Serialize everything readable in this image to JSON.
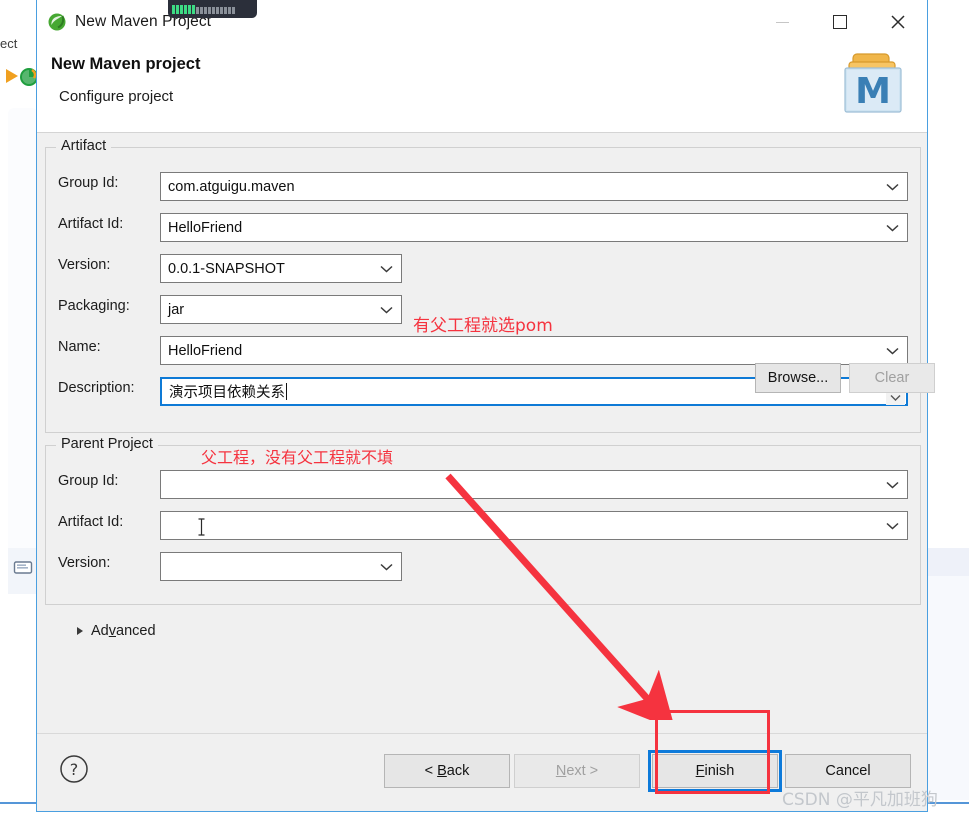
{
  "backdrop": {
    "toolbar_text": "ect",
    "run_icon": "run-icon",
    "maven_icon": "maven-green-icon",
    "view_icon": "console-view-icon"
  },
  "titlebar": {
    "icon": "maven-leaf-icon",
    "title": "New Maven Project",
    "minimize": "minimize-icon",
    "maximize": "maximize-icon",
    "close": "close-icon"
  },
  "header": {
    "title": "New Maven project",
    "subtitle": "Configure project",
    "logo": "maven-folder-m-icon"
  },
  "artifact": {
    "legend": "Artifact",
    "fields": [
      {
        "label": "Group Id:",
        "value": "com.atguigu.maven",
        "type": "combo-wide"
      },
      {
        "label": "Artifact Id:",
        "value": "HelloFriend",
        "type": "combo-wide"
      },
      {
        "label": "Version:",
        "value": "0.0.1-SNAPSHOT",
        "type": "combo-narrow"
      },
      {
        "label": "Packaging:",
        "value": "jar",
        "type": "combo-narrow"
      },
      {
        "label": "Name:",
        "value": "HelloFriend",
        "type": "combo-wide"
      },
      {
        "label": "Description:",
        "value": "演示项目依赖关系",
        "type": "text-focused"
      }
    ]
  },
  "parent": {
    "legend": "Parent Project",
    "fields": [
      {
        "label": "Group Id:",
        "value": "",
        "type": "combo-wide"
      },
      {
        "label": "Artifact Id:",
        "value": "",
        "type": "combo-wide"
      },
      {
        "label": "Version:",
        "value": "",
        "type": "combo-narrow"
      }
    ],
    "browse_label": "Browse...",
    "clear_label": "Clear"
  },
  "advanced": {
    "label_pre": "Ad",
    "label_mnemonic": "v",
    "label_post": "anced",
    "expanded": false
  },
  "footer": {
    "help_icon": "help-question-icon",
    "buttons": [
      {
        "name": "back",
        "pre": "< ",
        "mnemonic": "B",
        "post": "ack",
        "disabled": false,
        "focused": false
      },
      {
        "name": "next",
        "pre": "",
        "mnemonic": "N",
        "post": "ext >",
        "disabled": true,
        "focused": false
      },
      {
        "name": "finish",
        "pre": "",
        "mnemonic": "F",
        "post": "inish",
        "disabled": false,
        "focused": true
      },
      {
        "name": "cancel",
        "pre": "",
        "mnemonic": "",
        "post": "Cancel",
        "disabled": false,
        "focused": false
      }
    ]
  },
  "annotations": {
    "packaging_note": "有父工程就选pom",
    "parent_note": "父工程，没有父工程就不填",
    "arrow": "red-arrow-pointing-to-finish",
    "highlight_rect": "red-highlight-around-finish",
    "watermark": "CSDN @平凡加班狗"
  },
  "colors": {
    "accent": "#0d7ada",
    "annotation_red": "#f5333f",
    "dialog_bg": "#f0f0f0",
    "field_border": "#7a7a7a",
    "watermark": "#c3c7cc"
  }
}
